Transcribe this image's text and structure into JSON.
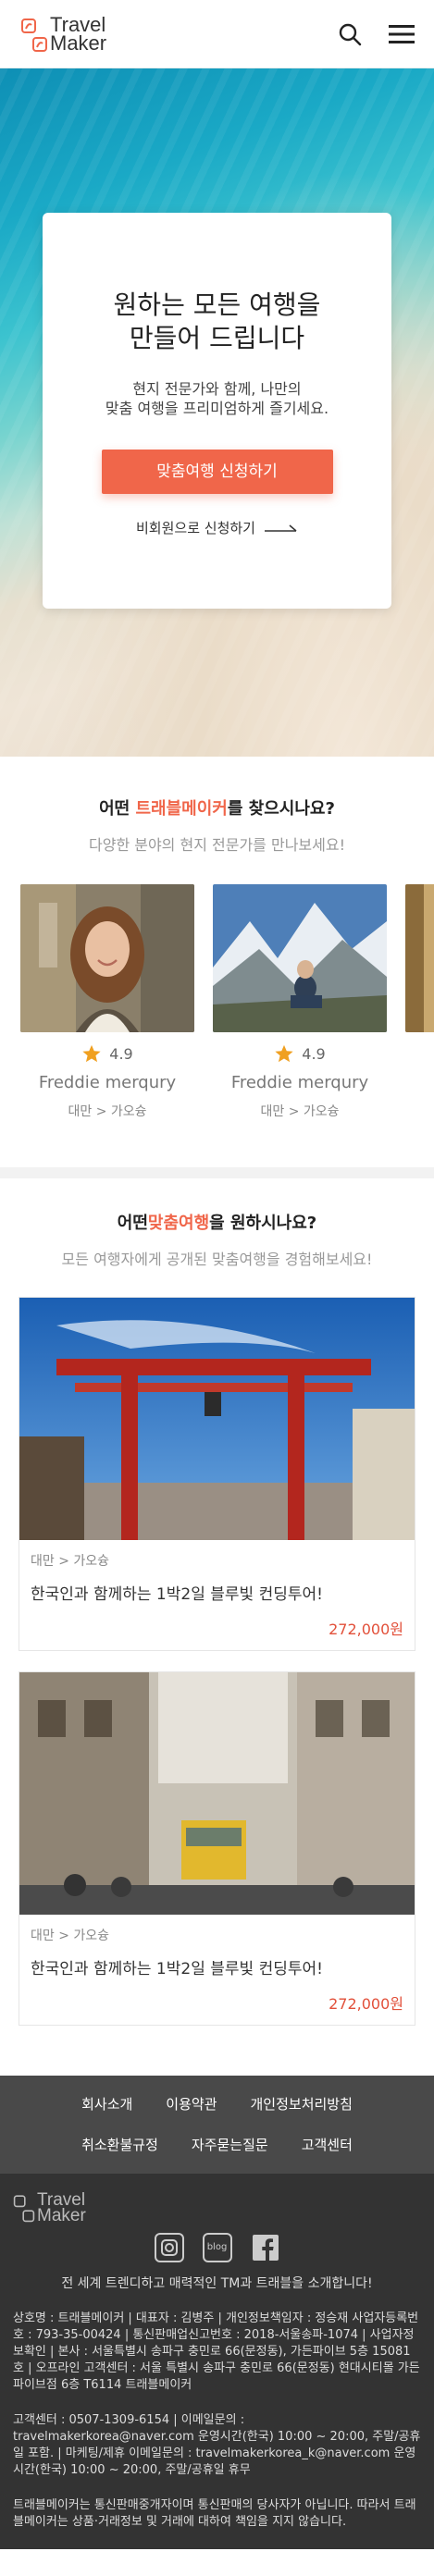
{
  "header": {
    "logo_text_1": "Travel",
    "logo_text_2": "Maker"
  },
  "hero": {
    "title": "원하는 모든 여행을\n만들어 드립니다",
    "subtitle": "현지 전문가와 함께, 나만의\n맞춤 여행을 프리미엄하게 즐기세요.",
    "cta_label": "맞춤여행 신청하기",
    "guest_link": "비회원으로 신청하기"
  },
  "experts_section": {
    "title_pre": "어떤 ",
    "title_hl": "트래블메이커",
    "title_post": "를 찾으시나요?",
    "subtitle": "다양한 분야의 현지 전문가를 만나보세요!",
    "items": [
      {
        "rating": "4.9",
        "name": "Freddie merqury",
        "location": "대만 > 가오슝"
      },
      {
        "rating": "4.9",
        "name": "Freddie merqury",
        "location": "대만 > 가오슝"
      }
    ]
  },
  "tours_section": {
    "title_pre": "어떤",
    "title_hl": "맞춤여행",
    "title_post": "을 원하시나요?",
    "subtitle": "모든 여행자에게 공개된 맞춤여행을 경험해보세요!",
    "items": [
      {
        "location": "대만 > 가오슝",
        "title": "한국인과 함께하는 1박2일 블루빛 컨딩투어!",
        "price": "272,000원"
      },
      {
        "location": "대만 > 가오슝",
        "title": "한국인과 함께하는 1박2일 블루빛 컨딩투어!",
        "price": "272,000원"
      }
    ]
  },
  "footer_nav": {
    "row1": [
      "회사소개",
      "이용약관",
      "개인정보처리방침"
    ],
    "row2": [
      "취소환불규정",
      "자주묻는질문",
      "고객센터"
    ]
  },
  "footer": {
    "logo_text_1": "Travel",
    "logo_text_2": "Maker",
    "social": [
      "instagram",
      "blog",
      "facebook"
    ],
    "blog_label": "blog",
    "tagline": "전 세계 트렌디하고 매력적인 TM과 트래블을 소개합니다!",
    "company_info": "상호명 : 트래블메이커  |  대표자 : 김병주  |  개인정보책임자 : 정승재 사업자등록번호 : 793-35-00424  |  통신판매업신고번호 : 2018-서울송파-1074  |  사업자정보확인  |  본사 : 서울특별시 송파구 충민로 66(문정동), 가든파이브 5층 15081호  |  오프라인 고객센터 : 서울 특별시 송파구 충민로 66(문정동) 현대시티몰 가든파이브점 6층 T6114 트래블메이커",
    "contact_info": "고객센터 :  0507-1309-6154  |  이메일문의 : travelmakerkorea@naver.com  운영시간(한국) 10:00 ~ 20:00, 주말/공휴일 포함.  |  마케팅/제휴 이메일문의 : travelmakerkorea_k@naver.com  운영시간(한국) 10:00 ~ 20:00, 주말/공휴일 휴무",
    "disclaimer": "트래블메이커는 통신판매중개자이며 통신판매의 당사자가 아닙니다. 따라서 트래블메이커는 상품·거래정보 및 거래에 대하여 책임을 지지 않습니다."
  },
  "colors": {
    "accent": "#f0664a",
    "price": "#e2503a",
    "footer_nav_bg": "#494949",
    "footer_bg": "#333333"
  }
}
